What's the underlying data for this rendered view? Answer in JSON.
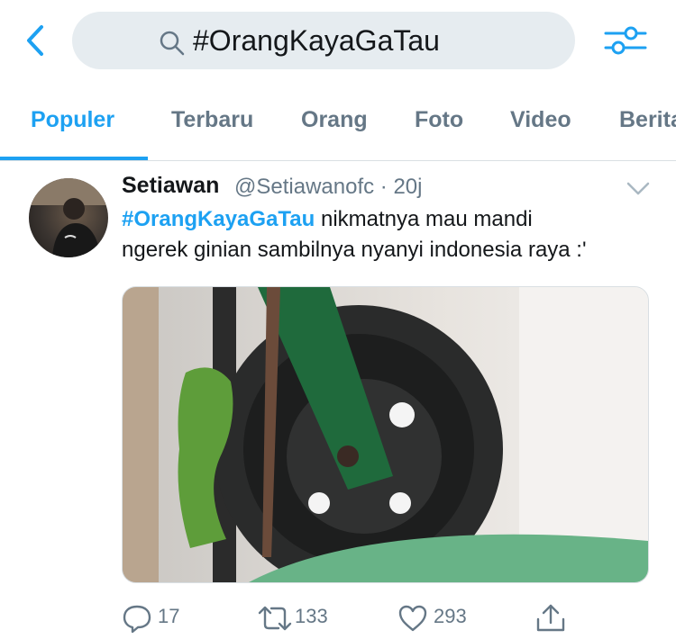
{
  "search": {
    "query": "#OrangKayaGaTau"
  },
  "icons": {
    "back": "back-arrow-icon",
    "search": "search-icon",
    "filter": "filter-sliders-icon",
    "caret": "chevron-down-icon",
    "reply": "reply-icon",
    "retweet": "retweet-icon",
    "like": "heart-icon",
    "share": "share-icon"
  },
  "tabs": [
    {
      "label": "Populer",
      "active": true
    },
    {
      "label": "Terbaru"
    },
    {
      "label": "Orang"
    },
    {
      "label": "Foto"
    },
    {
      "label": "Video"
    },
    {
      "label": "Berita"
    }
  ],
  "tweet": {
    "name": "Setiawan",
    "handle": "@Setiawanofc · 20j",
    "hashtag": "#OrangKayaGaTau",
    "line1_rest": " nikmatnya mau mandi",
    "line2": "ngerek ginian sambilnya nyanyi indonesia raya :'",
    "replies": "17",
    "retweets": "133",
    "likes": "293"
  },
  "colors": {
    "accent": "#1da1f2",
    "muted": "#657786",
    "search_bg": "#e6ecf0"
  }
}
